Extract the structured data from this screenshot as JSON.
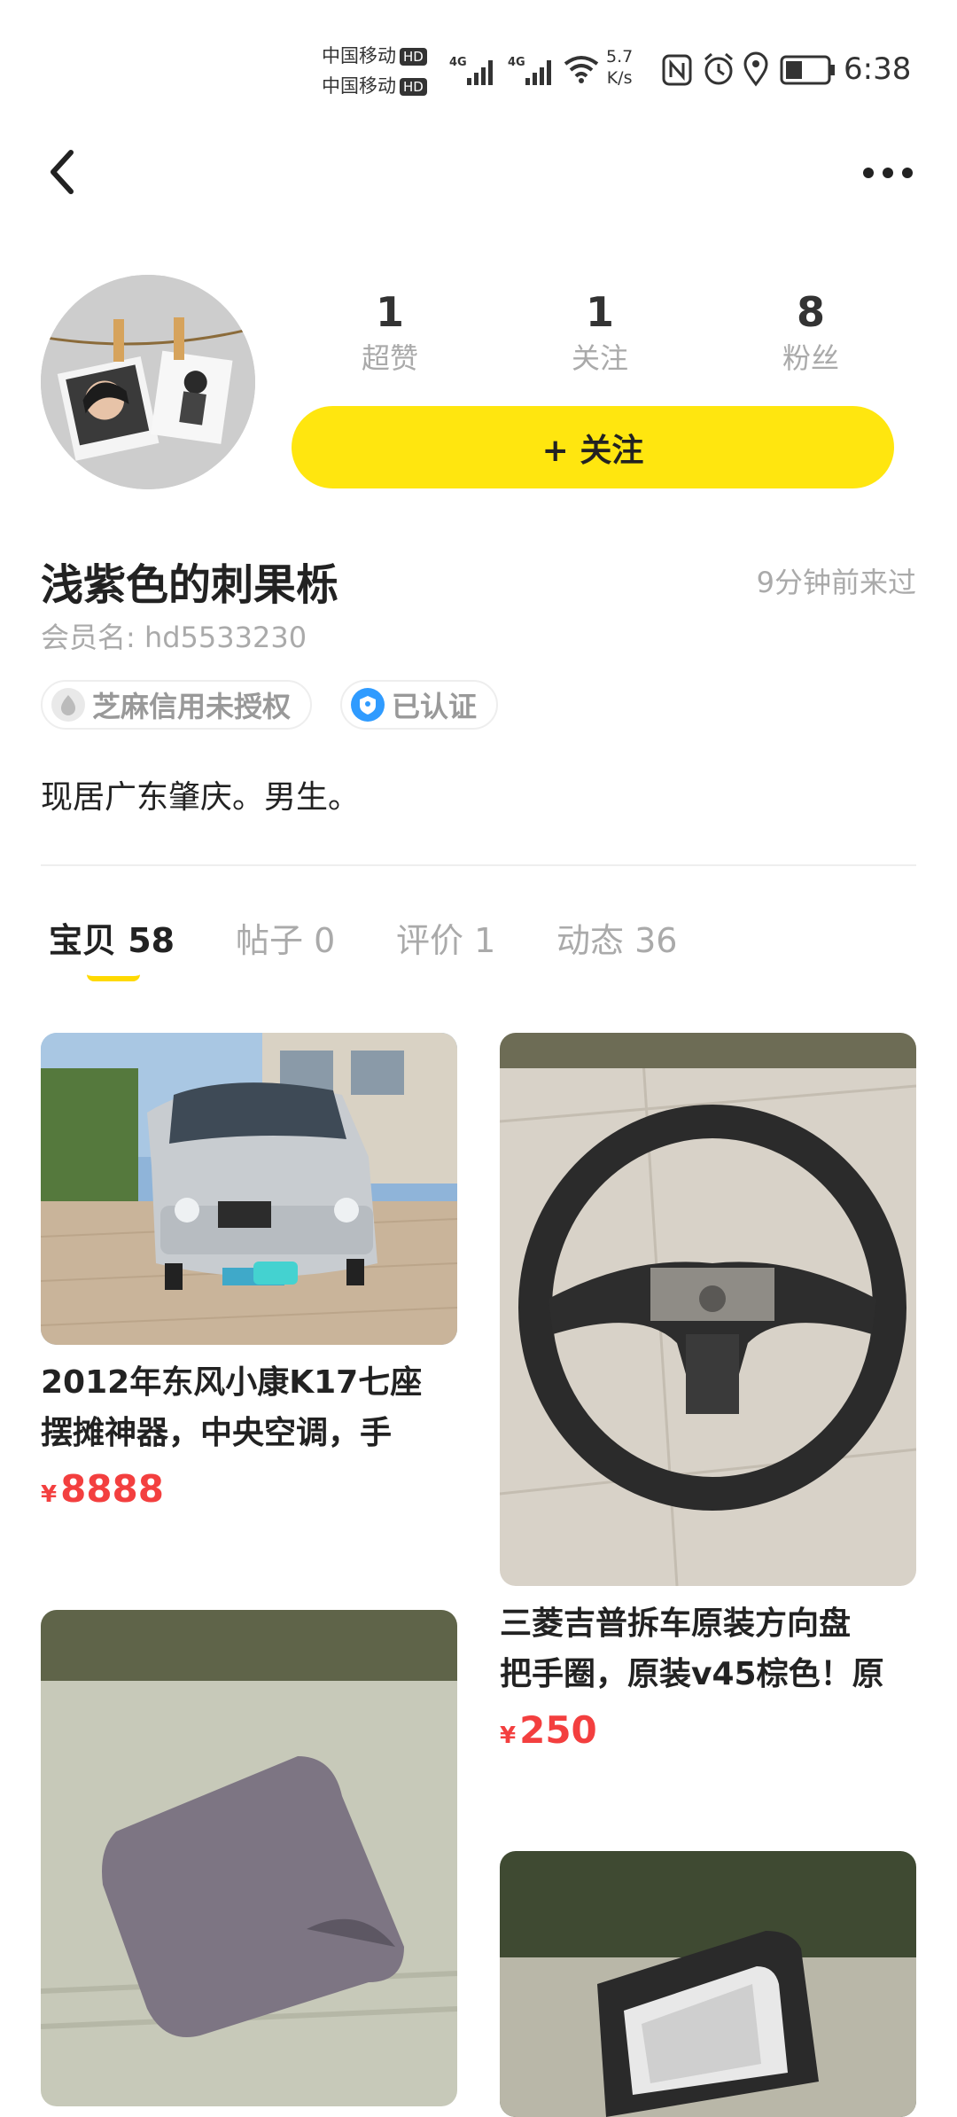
{
  "status_bar": {
    "carrier1": "中国移动",
    "carrier2": "中国移动",
    "hd": "HD",
    "net": "4G",
    "speed_value": "5.7",
    "speed_unit": "K/s",
    "time": "6:38"
  },
  "stats": [
    {
      "value": "1",
      "label": "超赞"
    },
    {
      "value": "1",
      "label": "关注"
    },
    {
      "value": "8",
      "label": "粉丝"
    }
  ],
  "follow_button": "+ 关注",
  "profile": {
    "nickname": "浅紫色的刺果栎",
    "last_seen": "9分钟前来过",
    "member_name": "会员名: hd5533230",
    "badges": [
      "芝麻信用未授权",
      "已认证"
    ],
    "bio": "现居广东肇庆。男生。"
  },
  "tabs": [
    {
      "label": "宝贝 58",
      "active": true
    },
    {
      "label": "帖子 0",
      "active": false
    },
    {
      "label": "评价 1",
      "active": false
    },
    {
      "label": "动态 36",
      "active": false
    }
  ],
  "items": [
    {
      "title_line1": "2012年东风小康K17七座",
      "title_line2": "摆摊神器，中央空调，手",
      "currency": "¥",
      "price": "8888",
      "image": "silver-van-photo"
    },
    {
      "title_line1": "三菱吉普拆车原装方向盘",
      "title_line2": "把手圈，原装v45棕色！原",
      "currency": "¥",
      "price": "250",
      "image": "steering-wheel-photo"
    },
    {
      "image": "gray-part-photo"
    },
    {
      "image": "light-lens-photo"
    }
  ],
  "colors": {
    "accent": "#FFE60F",
    "price": "#F33F3F",
    "muted": "#AAAAAA"
  }
}
